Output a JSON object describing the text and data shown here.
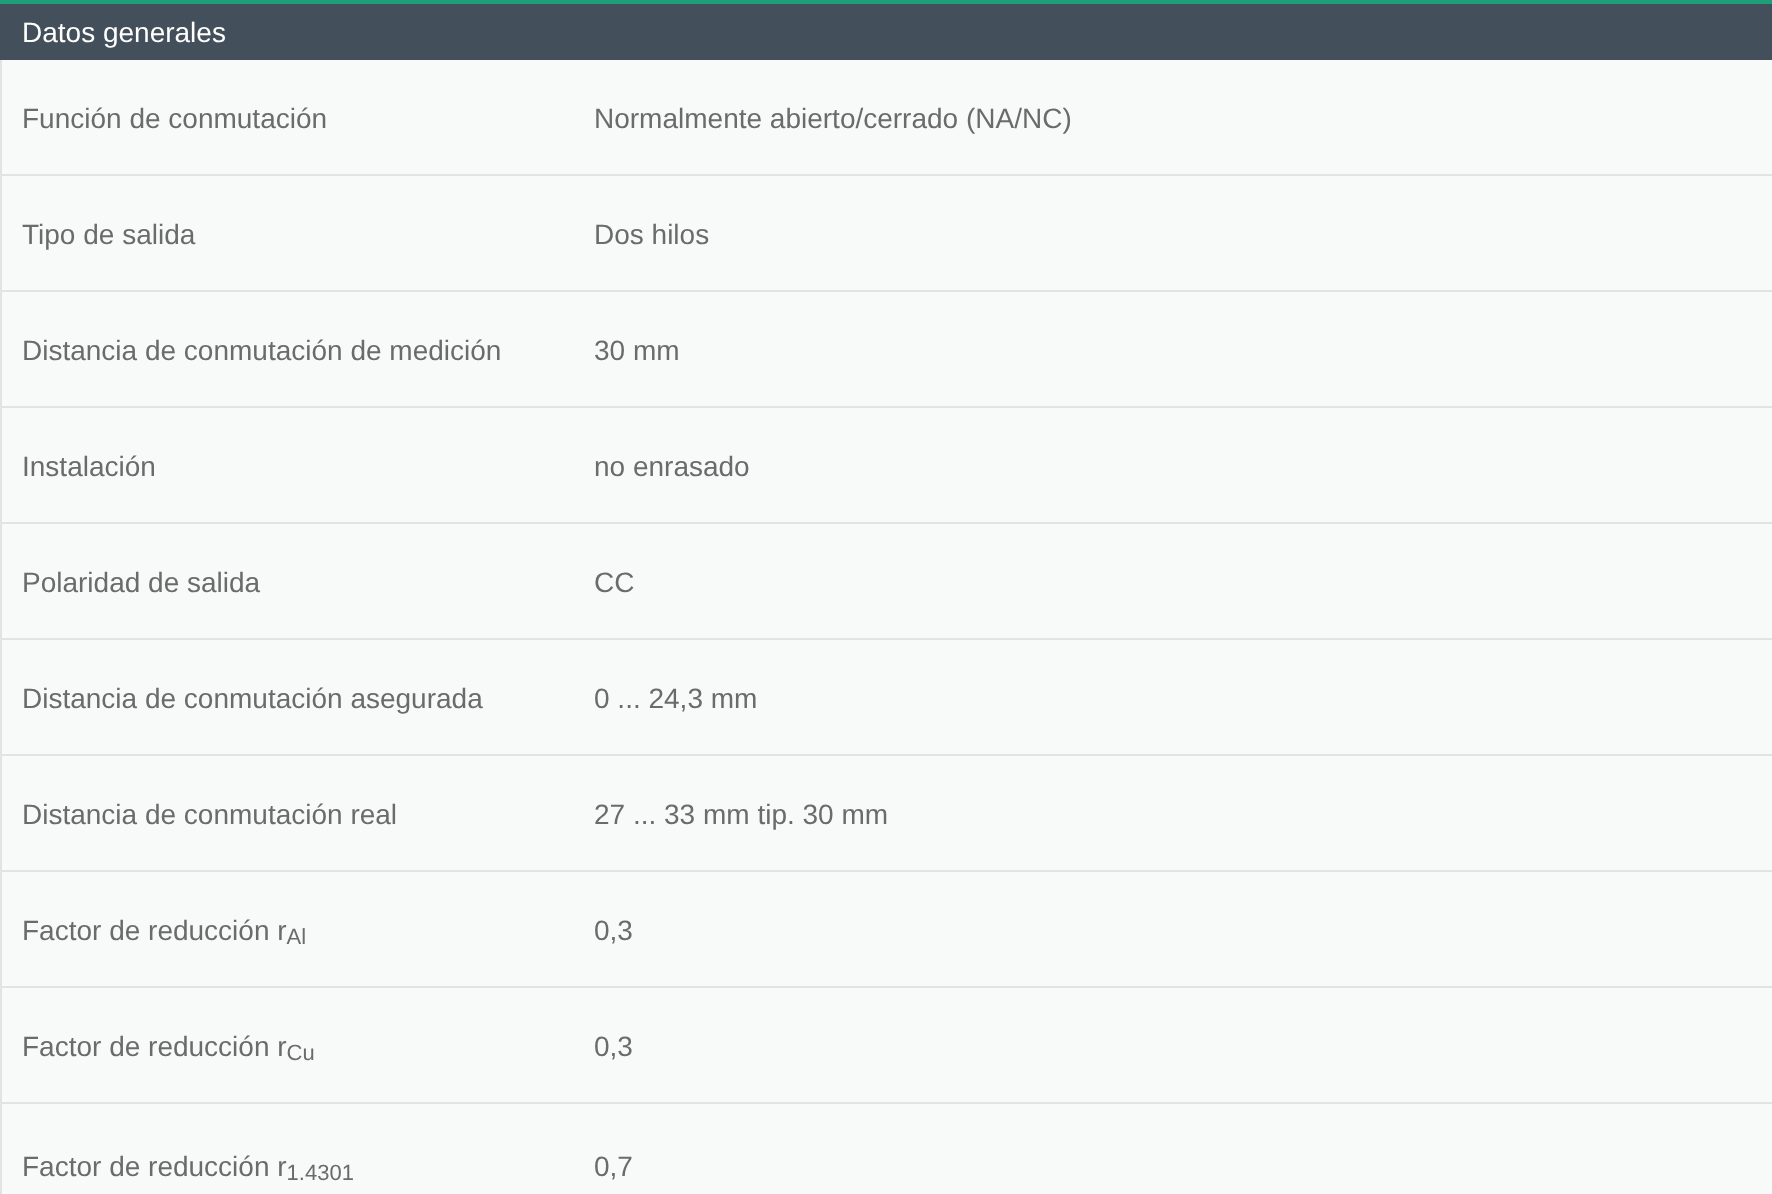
{
  "section": {
    "title": "Datos generales"
  },
  "rows": [
    {
      "label": "Función de conmutación",
      "value": "Normalmente abierto/cerrado (NA/NC)"
    },
    {
      "label": "Tipo de salida",
      "value": "Dos hilos"
    },
    {
      "label": "Distancia de conmutación de medición",
      "value": "30 mm"
    },
    {
      "label": "Instalación",
      "value": "no enrasado"
    },
    {
      "label": "Polaridad de salida",
      "value": "CC"
    },
    {
      "label": "Distancia de conmutación asegurada",
      "value": "0 ... 24,3 mm"
    },
    {
      "label": "Distancia de conmutación real",
      "value": "27 ... 33 mm tip. 30 mm"
    },
    {
      "label": "Factor de reducción r$_{Al}$",
      "value": "0,3"
    },
    {
      "label": "Factor de reducción r$_{Cu}$",
      "value": "0,3"
    },
    {
      "label": "Factor de reducción r$_{1.4301}$",
      "value": "0,7"
    }
  ]
}
